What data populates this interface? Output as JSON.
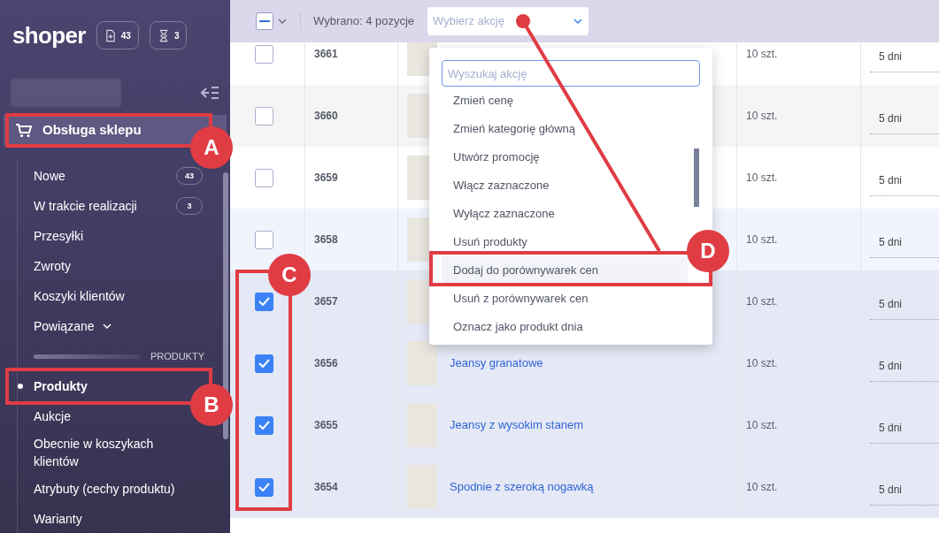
{
  "sidebar": {
    "logo": "shoper",
    "badges": [
      {
        "count": "43"
      },
      {
        "count": "3"
      }
    ],
    "section": {
      "title": "Obsługa sklepu",
      "expanded": true
    },
    "items": [
      {
        "kind": "link",
        "label": "Nowe",
        "count": "43",
        "selected": false
      },
      {
        "kind": "link",
        "label": "W trakcie realizacji",
        "count": "3",
        "selected": false
      },
      {
        "kind": "link",
        "label": "Przesyłki",
        "selected": false
      },
      {
        "kind": "link",
        "label": "Zwroty",
        "selected": false
      },
      {
        "kind": "link",
        "label": "Koszyki klientów",
        "selected": false
      },
      {
        "kind": "group",
        "label": "Powiązane",
        "selected": false
      },
      {
        "kind": "divider",
        "label": "PRODUKTY"
      },
      {
        "kind": "link",
        "label": "Produkty",
        "selected": true
      },
      {
        "kind": "link",
        "label": "Aukcje",
        "selected": false
      },
      {
        "kind": "link",
        "label": "Obecnie w koszykach klientów",
        "selected": false
      },
      {
        "kind": "link",
        "label": "Atrybuty (cechy produktu)",
        "selected": false
      },
      {
        "kind": "link",
        "label": "Warianty",
        "selected": false
      }
    ]
  },
  "toolbar": {
    "select_all_indeterminate": true,
    "selection_text": "Wybrano: 4 pozycje",
    "action_select": {
      "placeholder": "Wybierz akcję",
      "expanded": true
    }
  },
  "action_menu": {
    "search": {
      "placeholder": "Wyszukaj akcję"
    },
    "items": [
      {
        "label": "Zmień cenę",
        "selected": false
      },
      {
        "label": "Zmień kategorię główną",
        "selected": false
      },
      {
        "label": "Utwórz promocję",
        "selected": false
      },
      {
        "label": "Włącz zaznaczone",
        "selected": false
      },
      {
        "label": "Wyłącz zaznaczone",
        "selected": false
      },
      {
        "label": "Usuń produkty",
        "selected": false
      },
      {
        "label": "Dodaj do porównywarek cen",
        "selected": true
      },
      {
        "label": "Usuń z porównywarek cen",
        "selected": false
      },
      {
        "label": "Oznacz jako produkt dnia",
        "selected": false
      }
    ]
  },
  "table": {
    "rows": [
      {
        "selected": false,
        "id": "3661",
        "stock": "10 szt.",
        "delivery": "5 dni"
      },
      {
        "selected": false,
        "id": "3660",
        "stock": "10 szt.",
        "delivery": "5 dni"
      },
      {
        "selected": false,
        "id": "3659",
        "stock": "10 szt.",
        "delivery": "5 dni"
      },
      {
        "selected": false,
        "hovered": true,
        "id": "3658",
        "stock": "10 szt.",
        "delivery": "5 dni"
      },
      {
        "selected": true,
        "id": "3657",
        "stock": "10 szt.",
        "delivery": "5 dni"
      },
      {
        "selected": true,
        "id": "3656",
        "name": "Jeansy granatowe",
        "stock": "10 szt.",
        "delivery": "5 dni"
      },
      {
        "selected": true,
        "id": "3655",
        "name": "Jeansy z wysokim stanem",
        "stock": "10 szt.",
        "delivery": "5 dni"
      },
      {
        "selected": true,
        "id": "3654",
        "name": "Spodnie z szeroką nogawką",
        "stock": "10 szt.",
        "delivery": "5 dni"
      }
    ]
  },
  "annotations": [
    {
      "label": "A"
    },
    {
      "label": "B"
    },
    {
      "label": "C"
    },
    {
      "label": "D"
    }
  ]
}
